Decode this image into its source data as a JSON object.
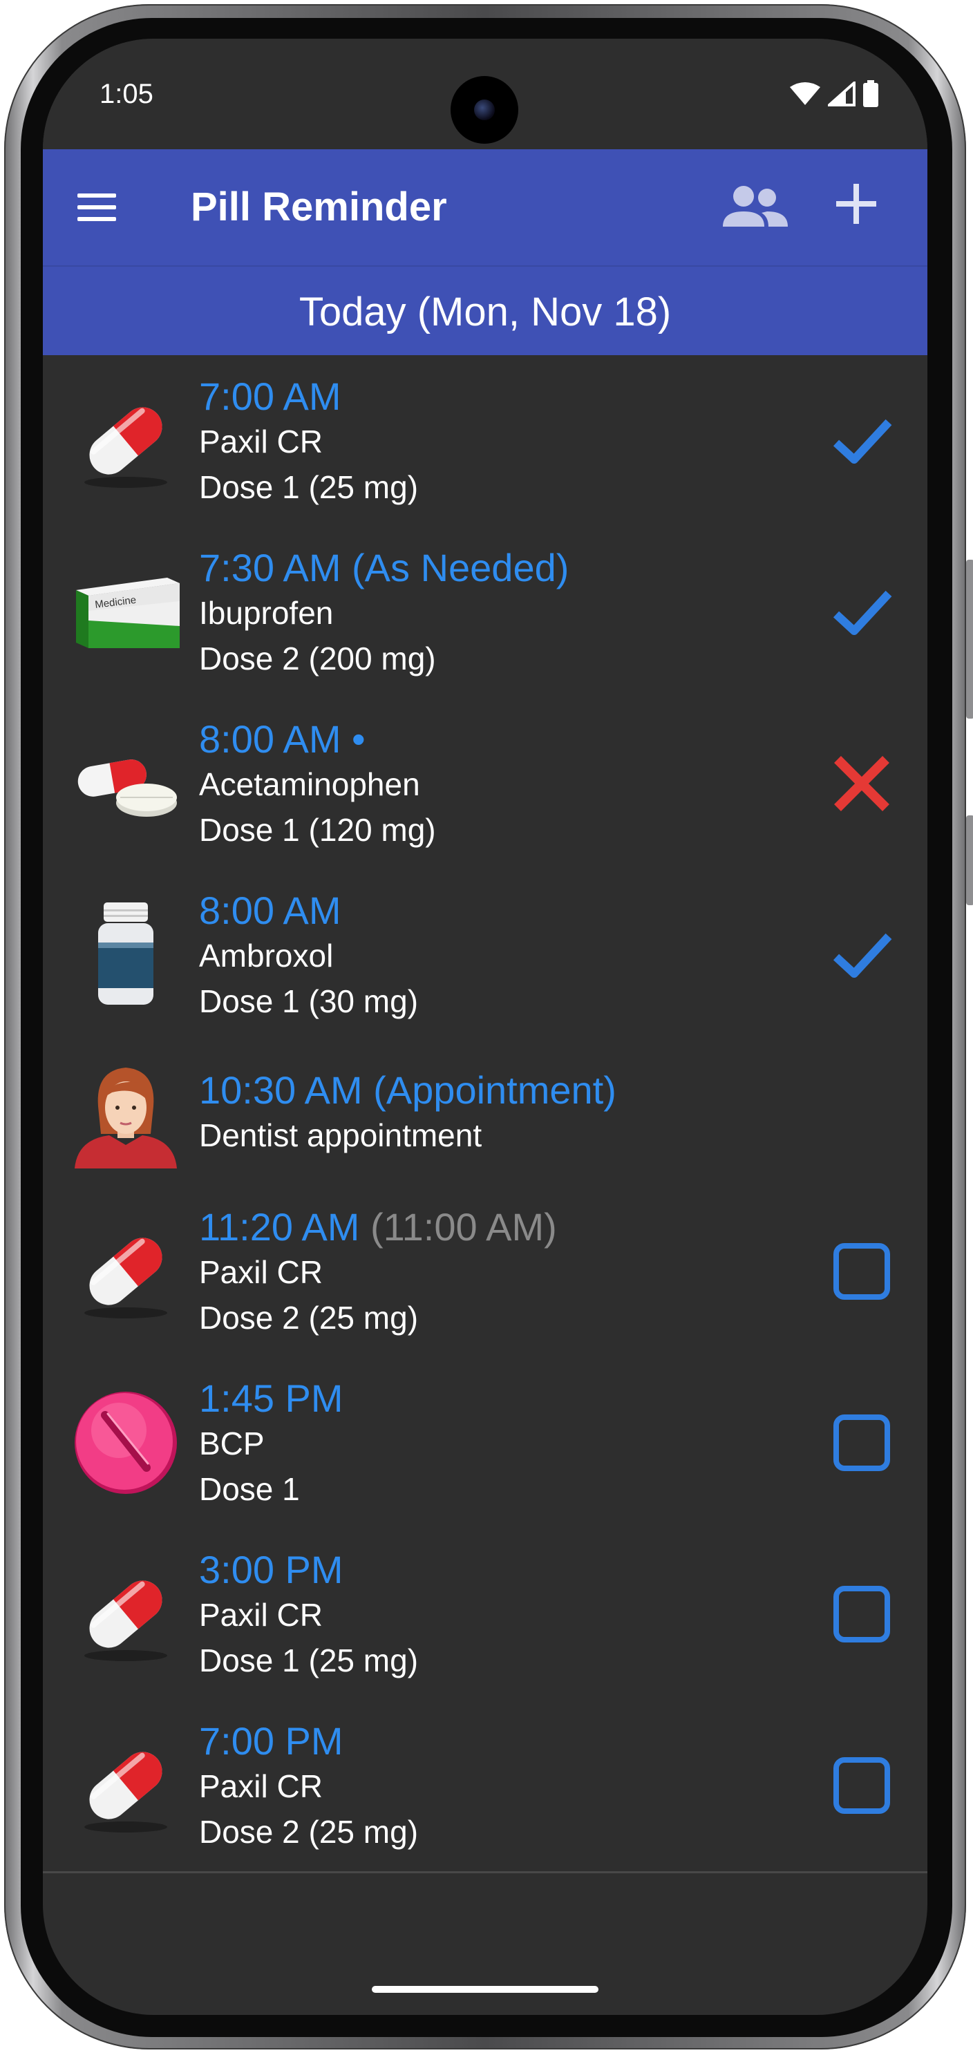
{
  "status_bar": {
    "time": "1:05"
  },
  "appbar": {
    "title": "Pill Reminder",
    "menu_icon": "hamburger-menu-icon",
    "profiles_icon": "people-icon",
    "add_icon": "plus-icon",
    "color": "#3f51b5"
  },
  "date_header": {
    "label": "Today (Mon, Nov 18)"
  },
  "colors": {
    "time_blue": "#2f8df0",
    "check_blue": "#2f7de0",
    "cross_red": "#e53935",
    "background": "#2e2e2e"
  },
  "reminders": [
    {
      "time": "7:00 AM",
      "name": "Paxil CR",
      "dose": "Dose 1 (25 mg)",
      "image": "capsule",
      "status": "taken"
    },
    {
      "time": "7:30 AM (As Needed)",
      "name": "Ibuprofen",
      "dose": "Dose 2 (200 mg)",
      "image": "medicine-box",
      "box_label": "Medicine",
      "status": "taken"
    },
    {
      "time": "8:00 AM •",
      "name": "Acetaminophen",
      "dose": "Dose 1 (120 mg)",
      "image": "capsule-and-tablet",
      "status": "skipped"
    },
    {
      "time": "8:00 AM",
      "name": "Ambroxol",
      "dose": "Dose 1 (30 mg)",
      "image": "bottle",
      "status": "taken"
    },
    {
      "time": "10:30 AM (Appointment)",
      "name": "Dentist appointment",
      "image": "person-avatar",
      "status": "none"
    },
    {
      "time": "11:20 AM",
      "original_time": "(11:00 AM)",
      "name": "Paxil CR",
      "dose": "Dose 2 (25 mg)",
      "image": "capsule",
      "status": "pending"
    },
    {
      "time": "1:45 PM",
      "name": "BCP",
      "dose": "Dose 1",
      "image": "pink-tablet",
      "status": "pending"
    },
    {
      "time": "3:00 PM",
      "name": "Paxil CR",
      "dose": "Dose 1 (25 mg)",
      "image": "capsule",
      "status": "pending"
    },
    {
      "time": "7:00 PM",
      "name": "Paxil CR",
      "dose": "Dose 2 (25 mg)",
      "image": "capsule",
      "status": "pending"
    }
  ]
}
